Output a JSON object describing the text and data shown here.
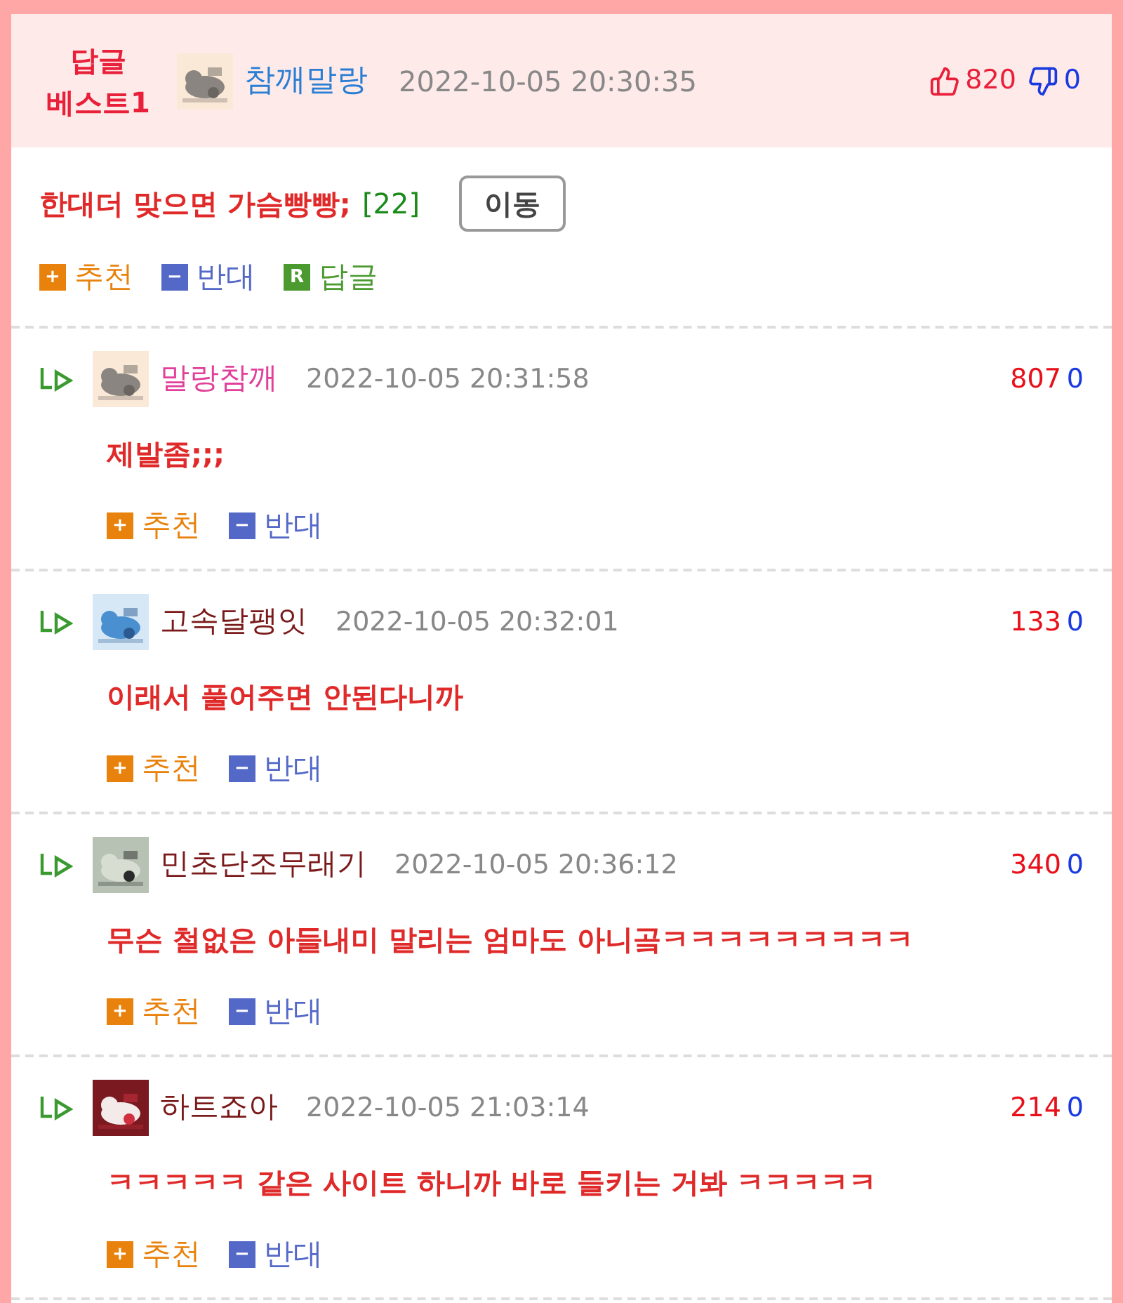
{
  "best": {
    "badge_line1": "답글",
    "badge_line2": "베스트1",
    "author": "참깨말랑",
    "color": "#2a7fd4",
    "avatar": {
      "kind": "picture"
    },
    "time": "2022-10-05 20:30:35",
    "likes": "820",
    "dislikes": "0",
    "text": "한대더 맞으면 가슴빵빵;",
    "count": "[22]",
    "move_button": "이동",
    "actions": [
      {
        "kind": "up",
        "mark": "+",
        "label": "추천"
      },
      {
        "kind": "down",
        "mark": "−",
        "label": "반대"
      },
      {
        "kind": "reply",
        "mark": "R",
        "label": "답글"
      }
    ]
  },
  "replies": [
    {
      "author": "말랑참깨",
      "color": "#e0409a",
      "avatar": {
        "kind": "picture"
      },
      "time": "2022-10-05 20:31:58",
      "likes": "807",
      "dislikes": "0",
      "text": "제발좀;;;",
      "actions": [
        {
          "kind": "up",
          "mark": "+",
          "label": "추천"
        },
        {
          "kind": "down",
          "mark": "−",
          "label": "반대"
        }
      ]
    },
    {
      "author": "고속달팽잇",
      "color": "#7a1a1a",
      "avatar": {
        "kind": "picture"
      },
      "time": "2022-10-05 20:32:01",
      "likes": "133",
      "dislikes": "0",
      "text": "이래서 풀어주면 안된다니까",
      "actions": [
        {
          "kind": "up",
          "mark": "+",
          "label": "추천"
        },
        {
          "kind": "down",
          "mark": "−",
          "label": "반대"
        }
      ]
    },
    {
      "author": "민초단조무래기",
      "color": "#7a1a1a",
      "avatar": {
        "kind": "picture"
      },
      "time": "2022-10-05 20:36:12",
      "likes": "340",
      "dislikes": "0",
      "text": "무슨 철없은 아들내미 말리는 엄마도 아니곸ㅋㅋㅋㅋㅋㅋㅋㅋㅋ",
      "actions": [
        {
          "kind": "up",
          "mark": "+",
          "label": "추천"
        },
        {
          "kind": "down",
          "mark": "−",
          "label": "반대"
        }
      ]
    },
    {
      "author": "하트죠아",
      "color": "#7a1a1a",
      "avatar": {
        "kind": "picture"
      },
      "time": "2022-10-05 21:03:14",
      "likes": "214",
      "dislikes": "0",
      "text": "ㅋㅋㅋㅋㅋ 같은 사이트 하니까 바로 들키는 거봐 ㅋㅋㅋㅋㅋ",
      "actions": [
        {
          "kind": "up",
          "mark": "+",
          "label": "추천"
        },
        {
          "kind": "down",
          "mark": "−",
          "label": "반대"
        }
      ]
    }
  ]
}
